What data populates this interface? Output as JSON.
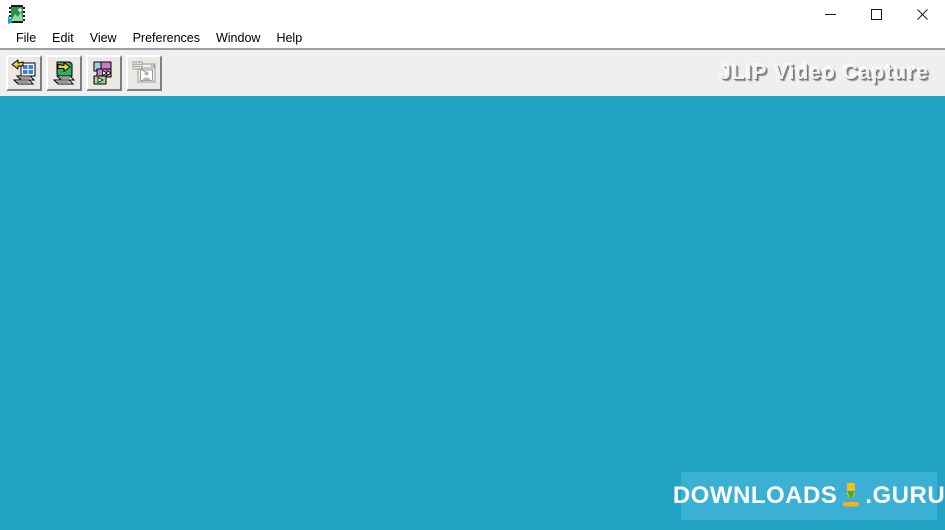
{
  "window": {
    "icon_name": "jlip-video-capture-app-icon",
    "title": "",
    "controls": {
      "minimize_label": "Minimize",
      "maximize_label": "Maximize",
      "close_label": "Close"
    }
  },
  "menubar": {
    "items": [
      {
        "label": "File",
        "name": "menu-file"
      },
      {
        "label": "Edit",
        "name": "menu-edit"
      },
      {
        "label": "View",
        "name": "menu-view"
      },
      {
        "label": "Preferences",
        "name": "menu-preferences"
      },
      {
        "label": "Window",
        "name": "menu-window"
      },
      {
        "label": "Help",
        "name": "menu-help"
      }
    ]
  },
  "toolbar": {
    "banner_text": "JLIP Video Capture",
    "buttons": [
      {
        "icon": "import-image-icon",
        "tooltip": "Import",
        "enabled": true
      },
      {
        "icon": "export-image-icon",
        "tooltip": "Export",
        "enabled": true
      },
      {
        "icon": "video-frames-play-icon",
        "tooltip": "Capture Video",
        "enabled": true
      },
      {
        "icon": "capture-window-person-icon",
        "tooltip": "Capture Still",
        "enabled": false
      }
    ]
  },
  "client": {
    "background_color": "#22a3c3"
  },
  "watermark": {
    "text_left": "DOWNLOADS",
    "text_right": ".GURU",
    "icon_name": "download-arrow-icon",
    "background_color": "#39b0d4"
  }
}
